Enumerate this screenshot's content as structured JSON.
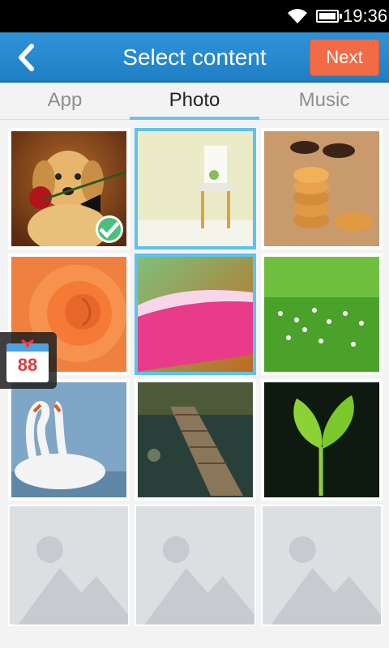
{
  "status_bar": {
    "time": "19:36",
    "wifi_icon": "wifi-icon",
    "battery_icon": "battery-icon"
  },
  "header": {
    "title": "Select content",
    "back_icon": "chevron-left-icon",
    "next_label": "Next"
  },
  "tabs": [
    {
      "label": "App",
      "active": false
    },
    {
      "label": "Photo",
      "active": true
    },
    {
      "label": "Music",
      "active": false
    }
  ],
  "gift_widget": {
    "number": "88",
    "icon": "gift-calendar-icon"
  },
  "photos": [
    {
      "subject": "puppy with rose",
      "checked": true,
      "highlighted": false
    },
    {
      "subject": "white chair",
      "checked": false,
      "highlighted": true
    },
    {
      "subject": "cookies",
      "checked": false,
      "highlighted": false
    },
    {
      "subject": "orange rose",
      "checked": false,
      "highlighted": false
    },
    {
      "subject": "pink petal macro",
      "checked": false,
      "highlighted": true
    },
    {
      "subject": "white flowers in grass",
      "checked": false,
      "highlighted": false
    },
    {
      "subject": "swans",
      "checked": false,
      "highlighted": false
    },
    {
      "subject": "game scene bridge",
      "checked": false,
      "highlighted": false
    },
    {
      "subject": "green leaf sprout",
      "checked": false,
      "highlighted": false
    },
    {
      "subject": "placeholder",
      "checked": false,
      "highlighted": false
    },
    {
      "subject": "placeholder",
      "checked": false,
      "highlighted": false
    },
    {
      "subject": "placeholder",
      "checked": false,
      "highlighted": false
    }
  ],
  "colors": {
    "header": "#2389cf",
    "next": "#f26b46",
    "tab_indicator": "#6ec3ec",
    "check": "#4cbf7a"
  }
}
